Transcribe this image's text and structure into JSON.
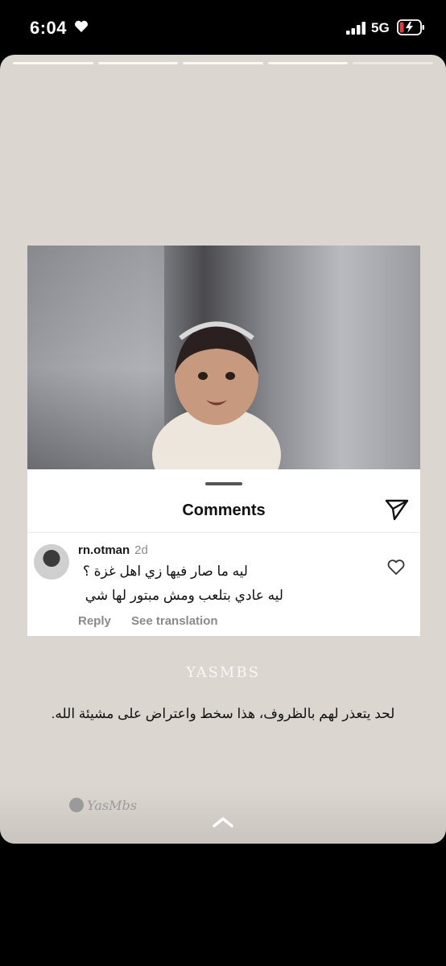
{
  "status_bar": {
    "time": "6:04",
    "network": "5G"
  },
  "post": {
    "sheet_title": "Comments",
    "comment": {
      "username": "rn.otman",
      "age": "2d",
      "line1": "ليه ما صار فيها زي اهل غزة ؟",
      "line2": "ليه عادي بتلعب ومش مبتور لها شي",
      "reply": "Reply",
      "translate": "See translation"
    }
  },
  "watermark_top": "YASMBS",
  "caption": "لحد يتعذر لهم بالظروف، هذا سخط واعتراض على مشيئة الله.",
  "watermark_bottom": "YasMbs",
  "icons": [
    "heart-icon",
    "signal-icon",
    "battery-icon",
    "send-icon",
    "like-icon",
    "chevron-up-icon"
  ]
}
